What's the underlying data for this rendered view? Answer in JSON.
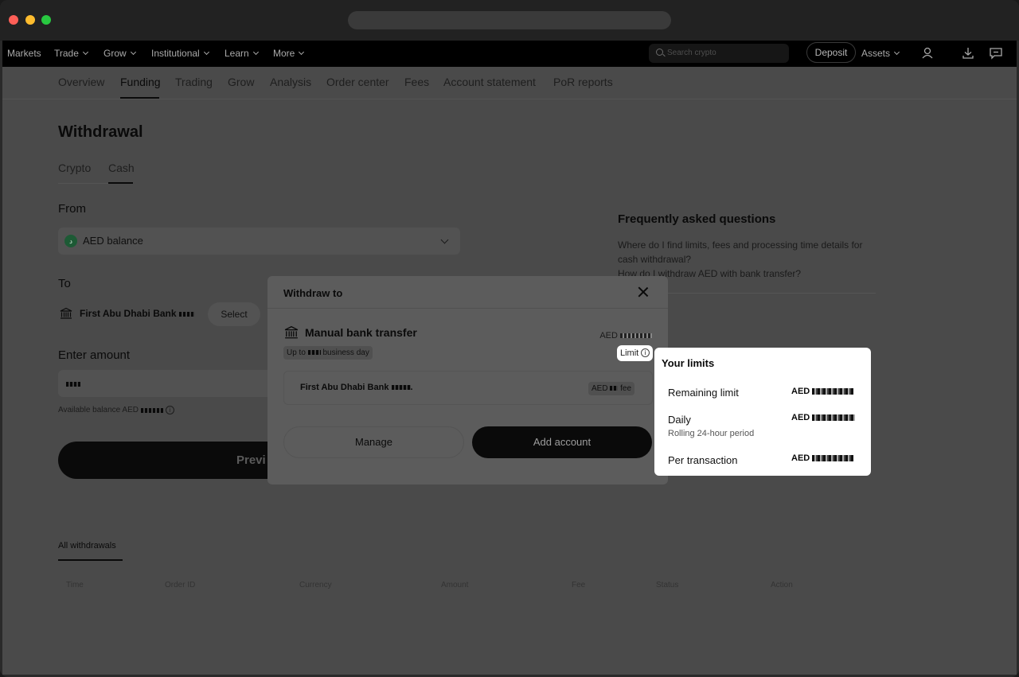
{
  "topnav": {
    "items": [
      {
        "label": "Markets",
        "has_menu": false
      },
      {
        "label": "Trade",
        "has_menu": true
      },
      {
        "label": "Grow",
        "has_menu": true
      },
      {
        "label": "Institutional",
        "has_menu": true
      },
      {
        "label": "Learn",
        "has_menu": true
      },
      {
        "label": "More",
        "has_menu": true
      }
    ],
    "search_placeholder": "Search crypto",
    "deposit_label": "Deposit",
    "assets_label": "Assets"
  },
  "subnav": {
    "tabs": [
      "Overview",
      "Funding",
      "Trading",
      "Grow",
      "Analysis",
      "Order center",
      "Fees",
      "Account statement",
      "PoR reports"
    ],
    "active": "Funding"
  },
  "withdrawal": {
    "title": "Withdrawal",
    "tabs": [
      "Crypto",
      "Cash"
    ],
    "active_tab": "Cash",
    "from_label": "From",
    "from_value": "AED balance",
    "to_label": "To",
    "to_bank": "First Abu Dhabi Bank",
    "select_label": "Select",
    "amount_label": "Enter amount",
    "available_label": "Available balance AED",
    "preview_label": "Previ"
  },
  "faq": {
    "title": "Frequently asked questions",
    "questions": [
      "Where do I find limits, fees and processing time details for cash withdrawal?",
      "How do I withdraw AED with bank transfer?"
    ]
  },
  "history": {
    "tab": "All withdrawals",
    "columns": [
      "Time",
      "Order ID",
      "Currency",
      "Amount",
      "Fee",
      "Status",
      "Action"
    ]
  },
  "modal": {
    "title": "Withdraw to",
    "method": "Manual bank transfer",
    "method_amount_prefix": "AED",
    "time_prefix": "Up to",
    "time_suffix": "business day",
    "limit_label": "Limit",
    "account_name": "First Abu Dhabi Bank",
    "fee_prefix": "AED",
    "fee_suffix": "fee",
    "manage_label": "Manage",
    "add_label": "Add account"
  },
  "limits_popover": {
    "title": "Your limits",
    "rows": [
      {
        "label": "Remaining limit",
        "sub": "",
        "value_prefix": "AED"
      },
      {
        "label": "Daily",
        "sub": "Rolling 24-hour period",
        "value_prefix": "AED"
      },
      {
        "label": "Per transaction",
        "sub": "",
        "value_prefix": "AED"
      }
    ]
  }
}
